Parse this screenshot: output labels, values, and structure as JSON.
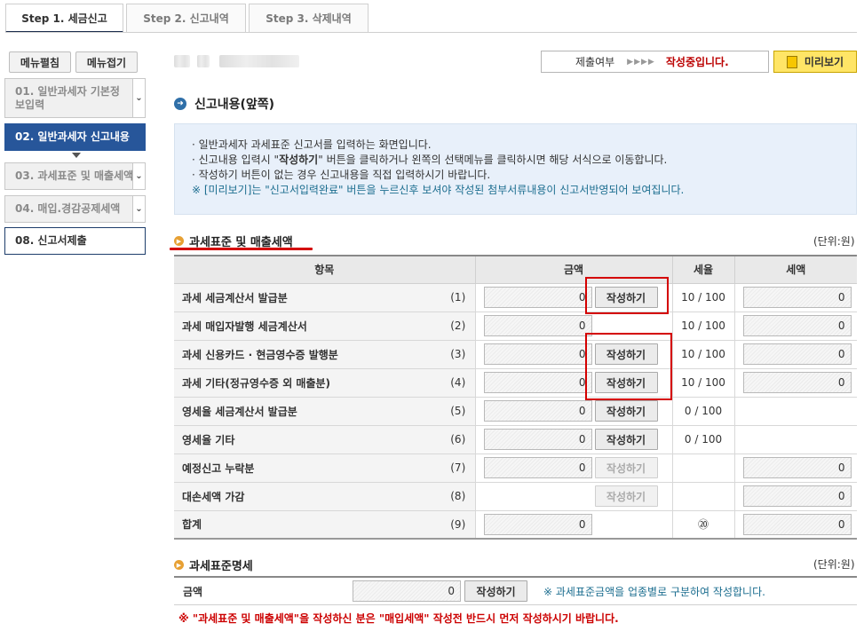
{
  "tabs": [
    {
      "label": "Step 1. 세금신고",
      "active": true
    },
    {
      "label": "Step 2. 신고내역",
      "active": false
    },
    {
      "label": "Step 3. 삭제내역",
      "active": false
    }
  ],
  "sidebar": {
    "edit_menu": "메뉴펼침",
    "collapse_menu": "메뉴접기",
    "items": [
      {
        "label": "01. 일반과세자 기본정보입력"
      },
      {
        "label": "02. 일반과세자 신고내용"
      },
      {
        "label": "03. 과세표준 및 매출세액"
      },
      {
        "label": "04. 매입.경감공제세액"
      },
      {
        "label": "08. 신고서제출"
      }
    ]
  },
  "header": {
    "status_label": "제출여부",
    "status_arrows": "▶▶▶▶",
    "status_value": "작성중입니다.",
    "preview_button": "미리보기"
  },
  "section": {
    "title": "신고내용(앞쪽)",
    "info_lines": [
      "· 일반과세자 과세표준 신고서를 입력하는 화면입니다.",
      "· 작성하기 버튼이 없는 경우 신고내용을 직접 입력하시기 바랍니다."
    ],
    "info_line2_pre": "· 신고내용 입력시 \"",
    "info_line2_bold": "작성하기",
    "info_line2_post": "\" 버튼을 클릭하거나 왼쪽의 선택메뉴를 클릭하시면 해당 서식으로 이동합니다.",
    "info_note": "※ [미리보기]는 \"신고서입력완료\" 버튼을 누르신후 보셔야 작성된 첨부서류내용이 신고서반영되어 보여집니다."
  },
  "tax_section": {
    "title": "과세표준 및 매출세액",
    "unit": "(단위:원)",
    "headers": [
      "항목",
      "금액",
      "세율",
      "세액"
    ],
    "rows": [
      {
        "item": "과세 세금계산서 발급분",
        "num": "(1)",
        "amount": "0",
        "button": "작성하기",
        "rate": "10 / 100",
        "tax": "0"
      },
      {
        "item": "과세 매입자발행 세금계산서",
        "num": "(2)",
        "amount": "0",
        "button": "",
        "rate": "10 / 100",
        "tax": "0"
      },
      {
        "item": "과세 신용카드 · 현금영수증 발행분",
        "num": "(3)",
        "amount": "0",
        "button": "작성하기",
        "rate": "10 / 100",
        "tax": "0"
      },
      {
        "item": "과세 기타(정규영수증 외 매출분)",
        "num": "(4)",
        "amount": "0",
        "button": "작성하기",
        "rate": "10 / 100",
        "tax": "0"
      },
      {
        "item": "영세율 세금계산서 발급분",
        "num": "(5)",
        "amount": "0",
        "button": "작성하기",
        "rate": "0 / 100",
        "tax": ""
      },
      {
        "item": "영세율 기타",
        "num": "(6)",
        "amount": "0",
        "button": "작성하기",
        "rate": "0 / 100",
        "tax": ""
      },
      {
        "item": "예정신고 누락분",
        "num": "(7)",
        "amount": "0",
        "button": "작성하기",
        "rate": "",
        "tax": "0"
      },
      {
        "item": "대손세액 가감",
        "num": "(8)",
        "amount": "",
        "button": "작성하기",
        "rate": "",
        "tax": "0"
      },
      {
        "item": "합계",
        "num": "(9)",
        "amount": "0",
        "button": "",
        "rate": "⑳",
        "tax": "0"
      }
    ]
  },
  "std_section": {
    "title": "과세표준명세",
    "unit": "(단위:원)",
    "label": "금액",
    "amount": "0",
    "button": "작성하기",
    "note": "※ 과세표준금액을 업종별로 구분하여 작성합니다."
  },
  "warning": "※ \"과세표준 및 매출세액\"을 작성하신 분은 \"매입세액\" 작성전 반드시 먼저 작성하시기 바랍니다."
}
